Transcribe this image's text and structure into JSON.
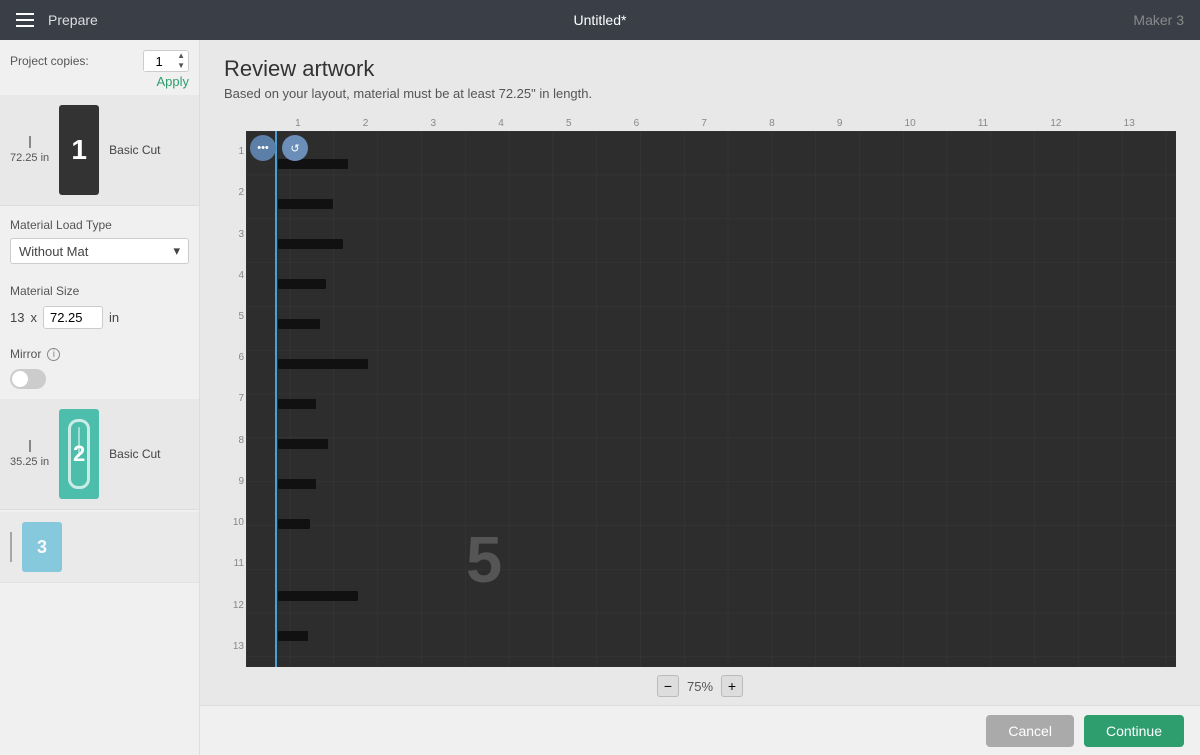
{
  "topbar": {
    "menu_label": "Menu",
    "app_name": "Prepare",
    "document_title": "Untitled*",
    "machine": "Maker 3"
  },
  "sidebar": {
    "project_copies_label": "Project copies:",
    "copies_value": "1",
    "apply_label": "Apply",
    "cut_items": [
      {
        "id": 1,
        "size_label": "72.25 in",
        "number": "1",
        "bg": "dark",
        "cut_type": "Basic Cut"
      },
      {
        "id": 2,
        "size_label": "35.25 in",
        "number": "2",
        "bg": "teal",
        "cut_type": "Basic Cut"
      },
      {
        "id": 3,
        "size_label": "",
        "number": "3",
        "bg": "blue",
        "cut_type": ""
      }
    ],
    "material_load_type_label": "Material Load Type",
    "material_load_value": "Without Mat",
    "material_size_label": "Material Size",
    "material_width": "13",
    "material_length": "72.25",
    "material_unit": "in",
    "mirror_label": "Mirror",
    "mirror_info": "i"
  },
  "review": {
    "title": "Review artwork",
    "subtitle": "Based on your layout, material must be at least 72.25\" in length."
  },
  "canvas": {
    "ruler_numbers_top": [
      "1",
      "2",
      "3",
      "4",
      "5",
      "6",
      "7",
      "8",
      "9",
      "10",
      "11",
      "12",
      "13"
    ],
    "ruler_numbers_left": [
      "1",
      "2",
      "3",
      "4",
      "5",
      "6",
      "7",
      "8",
      "9",
      "10",
      "11",
      "12",
      "13"
    ],
    "big_number": "5",
    "three_dot_btn": "•••",
    "rotate_btn": "↺"
  },
  "zoom": {
    "minus_label": "−",
    "value": "75%",
    "plus_label": "+"
  },
  "footer": {
    "cancel_label": "Cancel",
    "continue_label": "Continue"
  }
}
